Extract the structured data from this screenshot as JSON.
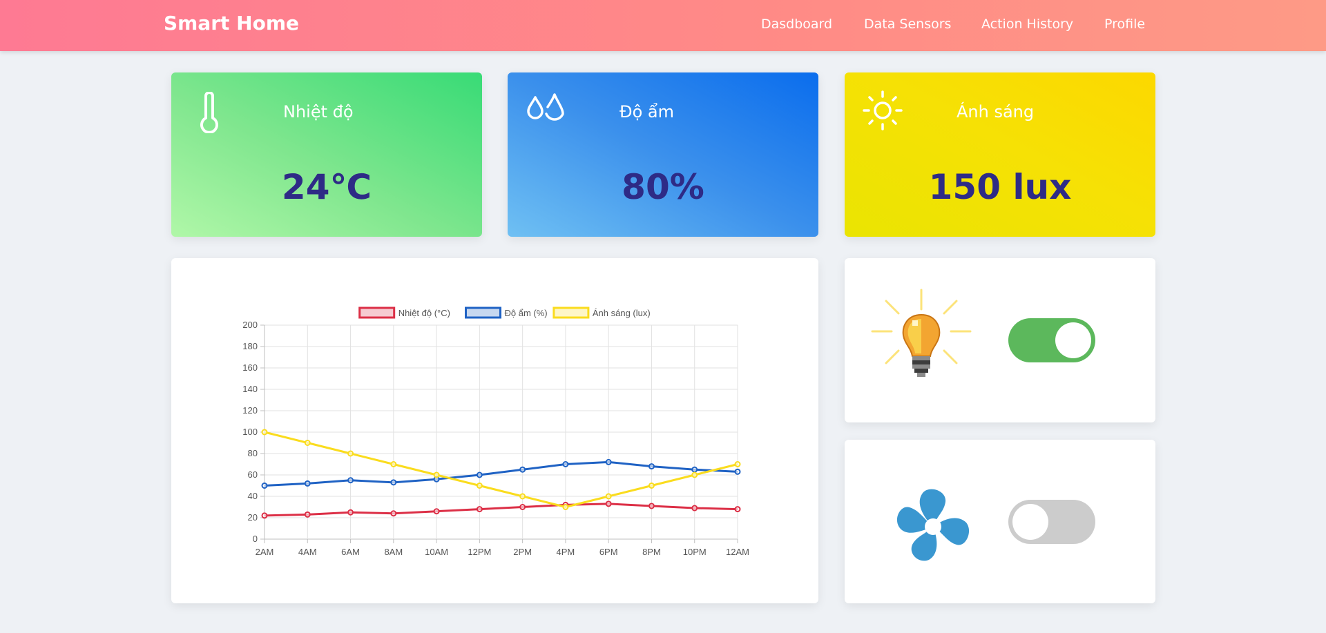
{
  "navbar": {
    "brand": "Smart Home",
    "links": [
      "Dasdboard",
      "Data Sensors",
      "Action History",
      "Profile"
    ]
  },
  "stats": {
    "temperature": {
      "label": "Nhiệt độ",
      "value": "24℃",
      "icon": "thermometer-icon"
    },
    "humidity": {
      "label": "Độ ẩm",
      "value": "80%",
      "icon": "water-drops-icon"
    },
    "light": {
      "label": "Ánh sáng",
      "value": "150 lux",
      "icon": "sun-icon"
    }
  },
  "colors": {
    "value_text": "#2e2b86",
    "temp_series": "#dc2f46",
    "hum_series": "#1f62c4",
    "light_series": "#fadc1e",
    "toggle_on": "#5cb85c",
    "toggle_off": "#cccccc"
  },
  "devices": {
    "light": {
      "icon": "light-bulb-icon",
      "on": true
    },
    "fan": {
      "icon": "fan-icon",
      "on": false
    }
  },
  "chart_data": {
    "type": "line",
    "categories": [
      "2AM",
      "4AM",
      "6AM",
      "8AM",
      "10AM",
      "12PM",
      "2PM",
      "4PM",
      "6PM",
      "8PM",
      "10PM",
      "12AM"
    ],
    "series": [
      {
        "name": "Nhiệt độ (°C)",
        "color": "#dc2f46",
        "values": [
          22,
          23,
          25,
          24,
          26,
          28,
          30,
          32,
          33,
          31,
          29,
          28
        ]
      },
      {
        "name": "Độ ẩm (%)",
        "color": "#1f62c4",
        "values": [
          50,
          52,
          55,
          53,
          56,
          60,
          65,
          70,
          72,
          68,
          65,
          63
        ]
      },
      {
        "name": "Ánh sáng (lux)",
        "color": "#fadc1e",
        "values": [
          100,
          90,
          80,
          70,
          60,
          50,
          40,
          30,
          40,
          50,
          60,
          70
        ]
      }
    ],
    "yticks": [
      0,
      20,
      40,
      60,
      80,
      100,
      120,
      140,
      160,
      180,
      200
    ],
    "ylim": [
      0,
      200
    ],
    "grid": true,
    "legend": "top-center"
  }
}
